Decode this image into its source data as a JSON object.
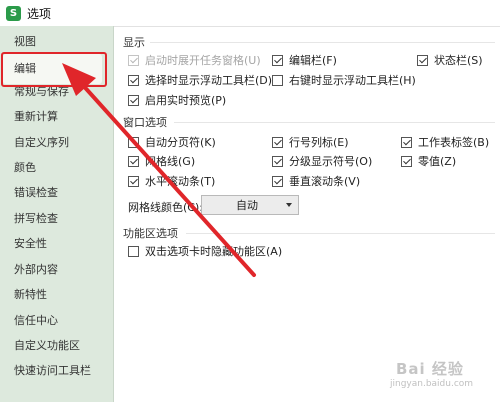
{
  "window": {
    "icon_letter": "S",
    "title": "选项"
  },
  "sidebar": {
    "items": [
      {
        "label": "视图"
      },
      {
        "label": "编辑"
      },
      {
        "label": "常规与保存"
      },
      {
        "label": "重新计算"
      },
      {
        "label": "自定义序列"
      },
      {
        "label": "颜色"
      },
      {
        "label": "错误检查"
      },
      {
        "label": "拼写检查"
      },
      {
        "label": "安全性"
      },
      {
        "label": "外部内容"
      },
      {
        "label": "新特性"
      },
      {
        "label": "信任中心"
      },
      {
        "label": "自定义功能区"
      },
      {
        "label": "快速访问工具栏"
      }
    ],
    "selected": "编辑"
  },
  "display": {
    "title": "显示",
    "options": [
      {
        "label": "启动时展开任务窗格(U)",
        "checked": true,
        "disabled": true
      },
      {
        "label": "编辑栏(F)",
        "checked": true
      },
      {
        "label": "状态栏(S)",
        "checked": true
      },
      {
        "label": "选择时显示浮动工具栏(D)",
        "checked": true
      },
      {
        "label": "右键时显示浮动工具栏(H)",
        "checked": false
      },
      {
        "label": "启用实时预览(P)",
        "checked": true
      }
    ]
  },
  "window_options": {
    "title": "窗口选项",
    "options": [
      {
        "label": "自动分页符(K)",
        "checked": false
      },
      {
        "label": "行号列标(E)",
        "checked": true
      },
      {
        "label": "工作表标签(B)",
        "checked": true
      },
      {
        "label": "网格线(G)",
        "checked": true
      },
      {
        "label": "分级显示符号(O)",
        "checked": true
      },
      {
        "label": "零值(Z)",
        "checked": true
      },
      {
        "label": "水平滚动条(T)",
        "checked": true
      },
      {
        "label": "垂直滚动条(V)",
        "checked": true
      }
    ],
    "grid_color_label": "网格线颜色(C):",
    "grid_color_value": "自动"
  },
  "ribbon": {
    "title": "功能区选项",
    "options": [
      {
        "label": "双击选项卡时隐藏功能区(A)",
        "checked": false
      }
    ]
  },
  "annotation": {
    "highlight_color": "#e0262a"
  },
  "watermark": {
    "text": "Bai 经验",
    "url": "jingyan.baidu.com"
  }
}
